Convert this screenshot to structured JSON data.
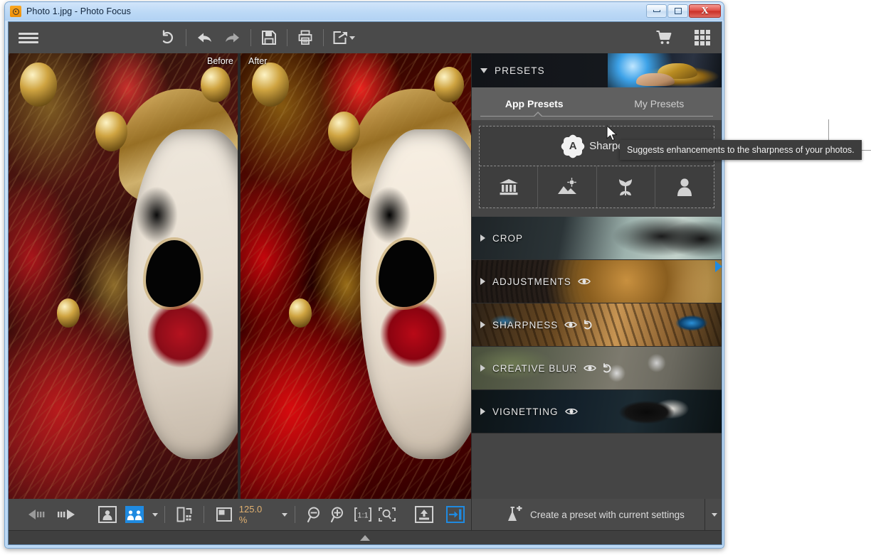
{
  "window": {
    "title": "Photo 1.jpg - Photo Focus",
    "app_icon": "photo-focus-icon",
    "controls": {
      "minimize": "minimize-button",
      "maximize": "maximize-button",
      "close_label": "X"
    }
  },
  "toolbar": {
    "menu": "hamburger-menu",
    "items": [
      {
        "name": "revert-button",
        "icon": "revert-arrow-icon"
      },
      {
        "name": "undo-button",
        "icon": "undo-arrow-icon"
      },
      {
        "name": "redo-button",
        "icon": "redo-arrow-icon"
      },
      {
        "name": "save-button",
        "icon": "floppy-disk-icon"
      },
      {
        "name": "print-button",
        "icon": "printer-icon"
      },
      {
        "name": "share-button",
        "icon": "share-export-icon"
      },
      {
        "name": "store-button",
        "icon": "shopping-cart-icon"
      },
      {
        "name": "apps-button",
        "icon": "grid-apps-icon"
      }
    ]
  },
  "viewer": {
    "before_label": "Before",
    "after_label": "After",
    "image_subject": "venetian-carnival-mask"
  },
  "presets": {
    "header_title": "PRESETS",
    "collapse_icon": "triangle-up-icon",
    "banner": "magic-lamp-banner",
    "tabs": [
      {
        "label": "App Presets",
        "active": true
      },
      {
        "label": "My Presets",
        "active": false
      }
    ],
    "main_preset": {
      "label": "Sharpen",
      "badge": "A",
      "badge_icon": "auto-starburst-icon"
    },
    "categories": [
      {
        "name": "architecture",
        "icon": "museum-building-icon"
      },
      {
        "name": "landscape",
        "icon": "landscape-sun-icon"
      },
      {
        "name": "nature",
        "icon": "tulip-flower-icon"
      },
      {
        "name": "portrait",
        "icon": "person-portrait-icon"
      }
    ]
  },
  "sections": [
    {
      "label": "CROP",
      "art": "art-crop",
      "expand_icon": "triangle-right-icon",
      "has_eye": false,
      "has_reset": false
    },
    {
      "label": "ADJUSTMENTS",
      "art": "art-adjust",
      "expand_icon": "triangle-right-icon",
      "has_eye": true,
      "has_reset": false
    },
    {
      "label": "SHARPNESS",
      "art": "art-sharp",
      "expand_icon": "triangle-right-icon",
      "has_eye": true,
      "has_reset": true
    },
    {
      "label": "CREATIVE BLUR",
      "art": "art-blur",
      "expand_icon": "triangle-right-icon",
      "has_eye": true,
      "has_reset": true
    },
    {
      "label": "VIGNETTING",
      "art": "art-vignette",
      "expand_icon": "triangle-right-icon",
      "has_eye": true,
      "has_reset": false
    }
  ],
  "bottombar": {
    "prev": "previous-image-button",
    "next": "next-image-button",
    "single_view": "single-view-button",
    "split_view": "split-view-button",
    "split_view_active": true,
    "rotate": "rotate-view-button",
    "fit_mode": "fit-mode-button",
    "zoom_value": "125.0 %",
    "zoom_out": "zoom-out-button",
    "zoom_in": "zoom-in-button",
    "zoom_actual": "zoom-1-to-1-button",
    "zoom_fit": "zoom-fit-button",
    "export": "export-button",
    "toggle_panel": "toggle-panel-button",
    "create_preset_label": "Create a preset with current settings",
    "create_preset_icon": "flask-plus-icon"
  },
  "tooltip": {
    "text": "Suggests enhancements to the sharpness of your photos."
  },
  "colors": {
    "accent_blue": "#1f8ae0",
    "zoom_text": "#e0b070",
    "panel_bg": "#454545",
    "toolbar_bg": "#4a4a4a"
  }
}
